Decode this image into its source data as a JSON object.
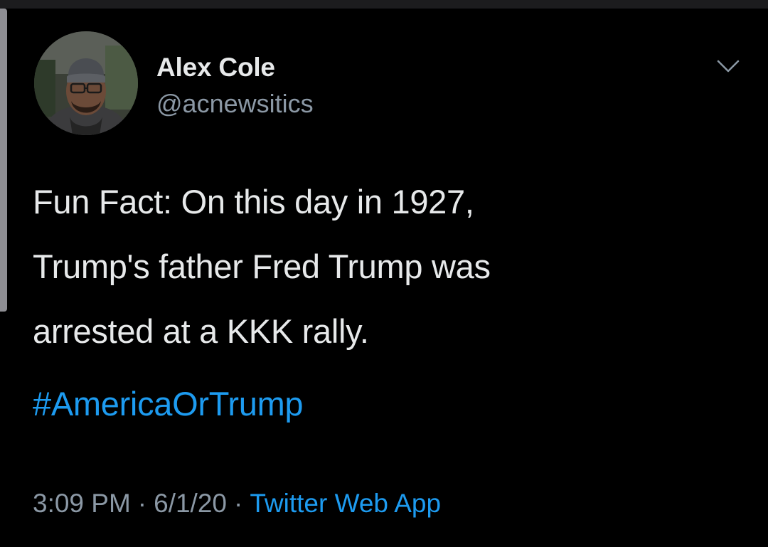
{
  "tweet": {
    "author": {
      "display_name": "Alex Cole",
      "handle": "@acnewsitics"
    },
    "text_lines": [
      "Fun Fact: On this day in 1927,",
      "Trump's father Fred Trump was",
      "arrested at a KKK rally."
    ],
    "hashtag": "#AmericaOrTrump",
    "meta": {
      "time": "3:09 PM",
      "separator": "·",
      "date": "6/1/20",
      "source": "Twitter Web App"
    },
    "icons": {
      "more": "chevron-down-icon",
      "avatar": "avatar"
    }
  },
  "colors": {
    "background": "#000000",
    "text_primary": "#e7e9ea",
    "text_secondary": "#8b98a5",
    "link": "#1d9bf0"
  }
}
